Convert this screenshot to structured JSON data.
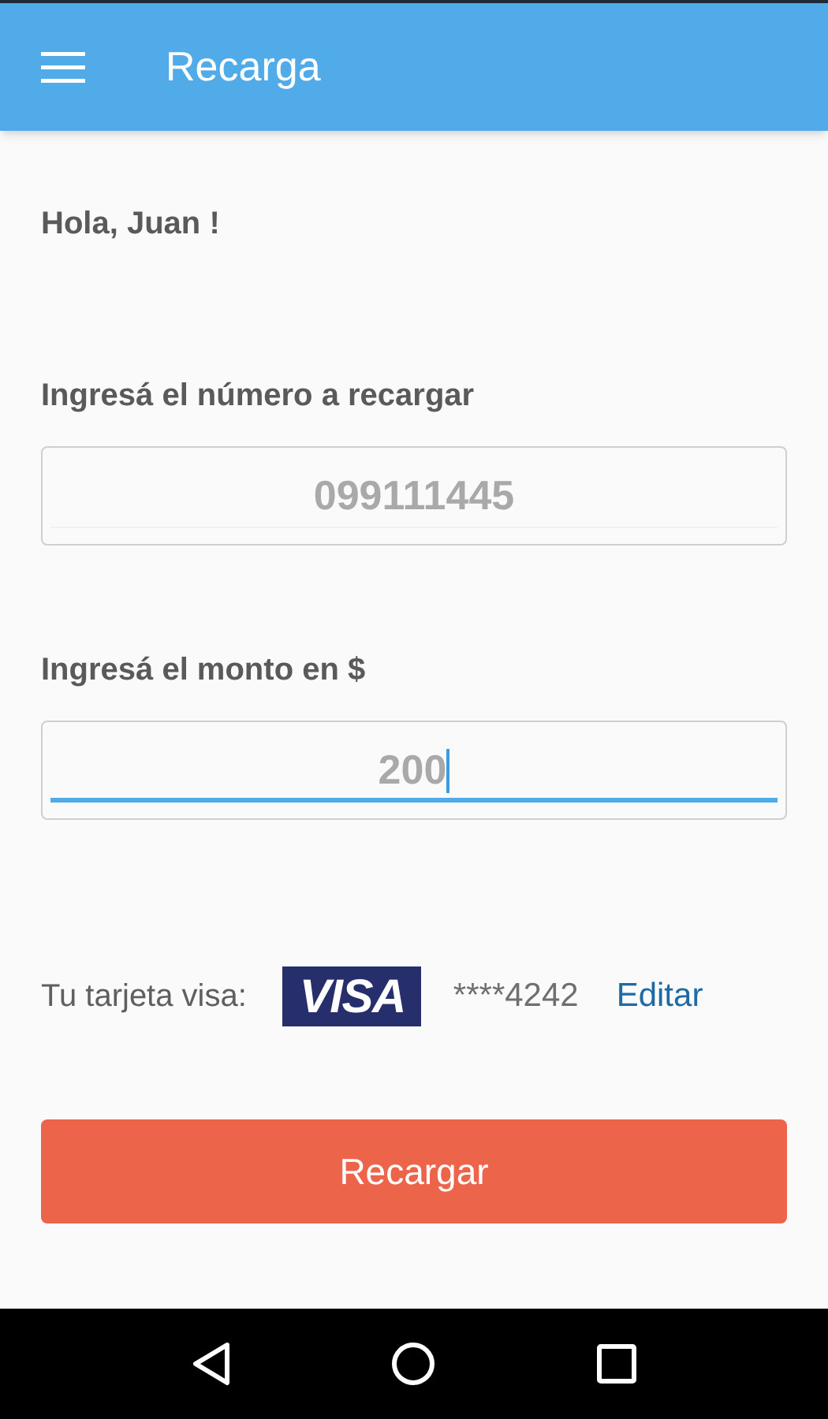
{
  "app_bar": {
    "title": "Recarga"
  },
  "greeting": "Hola, Juan !",
  "fields": [
    {
      "label": "Ingresá el número a recargar",
      "value": "099111445",
      "focused": false
    },
    {
      "label": "Ingresá el monto en $",
      "value": "200",
      "focused": true
    }
  ],
  "card": {
    "label": "Tu tarjeta visa:",
    "logo": "VISA",
    "number": "****4242",
    "edit_link": "Editar"
  },
  "submit_button": "Recargar"
}
